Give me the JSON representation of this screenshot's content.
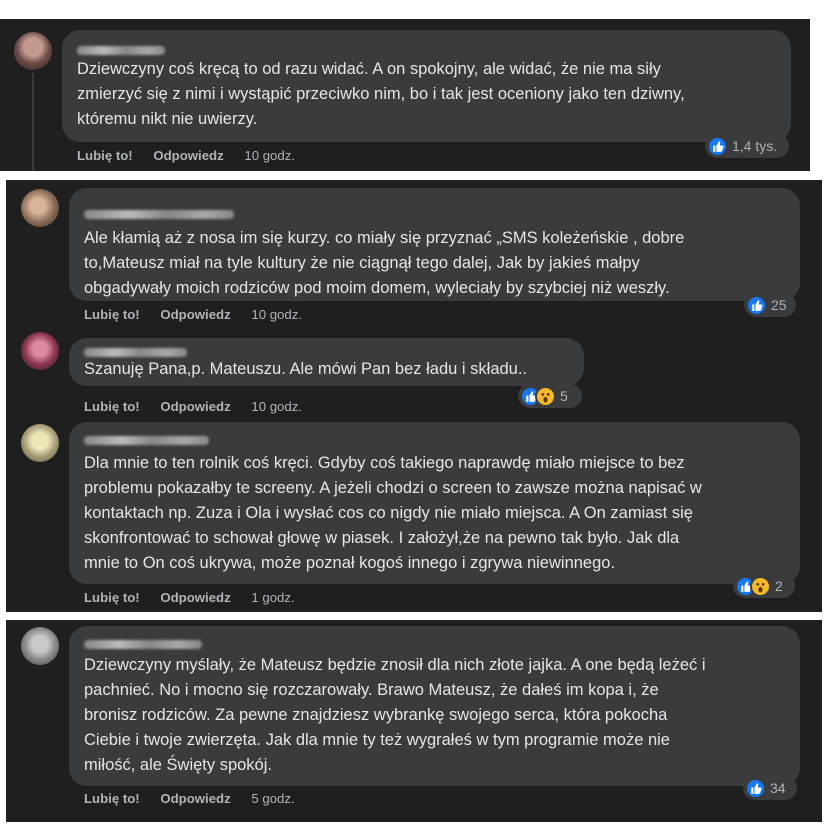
{
  "actions": {
    "like": "Lubię to!",
    "reply": "Odpowiedz"
  },
  "colors": {
    "panel": "#1f1f20",
    "bubble": "#3a3b3c",
    "text": "#e4e6eb",
    "meta": "#b0b3b8",
    "like": "#1877f2",
    "wow": "#f7b928"
  },
  "comments": [
    {
      "text": "Dziewczyny coś kręcą to od razu widać. A on spokojny, ale widać, że nie ma siły\nzmierzyć się z nimi i wystąpić przeciwko nim, bo i tak jest oceniony jako ten dziwny,\nktóremu nikt nie uwierzy.",
      "time": "10 godz.",
      "reaction_count": "1,4 tys.",
      "reactions": [
        "like-icon"
      ]
    },
    {
      "text": "Ale kłamią aż z nosa im się kurzy. co miały się przyznać „SMS koleżeńskie , dobre\nto,Mateusz miał na tyle kultury że nie ciągnął tego dalej, Jak by jakieś małpy\nobgadywały moich rodziców pod moim domem, wyleciały by szybciej niż weszły.",
      "time": "10 godz.",
      "reaction_count": "25",
      "reactions": [
        "like-icon"
      ]
    },
    {
      "text": "Szanuję Pana,p. Mateuszu. Ale mówi Pan bez ładu i składu..",
      "time": "10 godz.",
      "reaction_count": "5",
      "reactions": [
        "like-icon",
        "wow-icon"
      ]
    },
    {
      "text": "Dla mnie to ten rolnik coś kręci. Gdyby coś takiego naprawdę miało miejsce to bez\nproblemu pokazałby te screeny. A jeżeli chodzi o screen to zawsze można napisać w\nkontaktach np. Zuza i Ola i wysłać cos co nigdy nie miało miejsca. A On zamiast się\nskonfrontować to schował głowę w piasek. I założył,że na pewno tak było. Jak dla\nmnie to On coś ukrywa, może poznał kogoś innego i zgrywa niewinnego.",
      "time": "1 godz.",
      "reaction_count": "2",
      "reactions": [
        "like-icon",
        "wow-icon"
      ]
    },
    {
      "text": "Dziewczyny myślały, że Mateusz będzie znosił dla nich złote jajka. A one będą leżeć i\npachnieć. No i mocno się rozczarowały. Brawo Mateusz, że dałeś im kopa i, że\nbronisz rodziców. Za pewne znajdziesz wybrankę swojego serca, która pokocha\nCiebie i twoje zwierzęta. Jak dla mnie ty też wygrałeś w tym programie może nie\nmiłość, ale Święty spokój.",
      "time": "5 godz.",
      "reaction_count": "34",
      "reactions": [
        "like-icon"
      ]
    }
  ]
}
